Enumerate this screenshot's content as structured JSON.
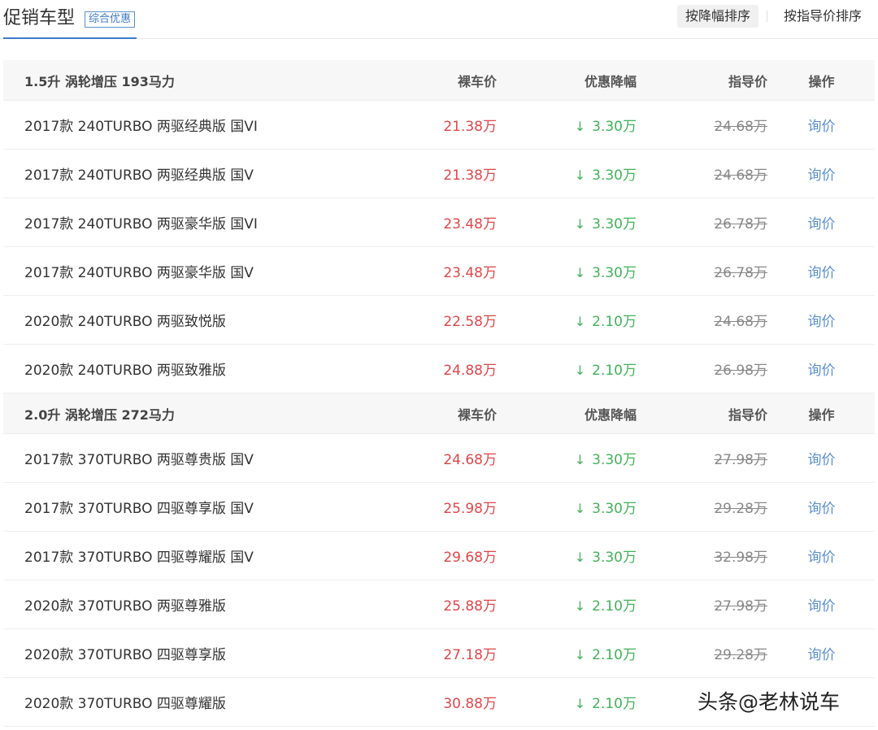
{
  "header": {
    "title": "促销车型",
    "badge": "综合优惠",
    "sort_discount": "按降幅排序",
    "sort_guide": "按指导价排序"
  },
  "groups": [
    {
      "name": "1.5升 涡轮增压 193马力",
      "col_price": "裸车价",
      "col_discount": "优惠降幅",
      "col_guide": "指导价",
      "col_op": "操作",
      "rows": [
        {
          "name": "2017款 240TURBO 两驱经典版 国VI",
          "price": "21.38万",
          "discount": "3.30万",
          "guide": "24.68万",
          "op": "询价"
        },
        {
          "name": "2017款 240TURBO 两驱经典版 国V",
          "price": "21.38万",
          "discount": "3.30万",
          "guide": "24.68万",
          "op": "询价"
        },
        {
          "name": "2017款 240TURBO 两驱豪华版 国VI",
          "price": "23.48万",
          "discount": "3.30万",
          "guide": "26.78万",
          "op": "询价"
        },
        {
          "name": "2017款 240TURBO 两驱豪华版 国V",
          "price": "23.48万",
          "discount": "3.30万",
          "guide": "26.78万",
          "op": "询价"
        },
        {
          "name": "2020款 240TURBO 两驱致悦版",
          "price": "22.58万",
          "discount": "2.10万",
          "guide": "24.68万",
          "op": "询价"
        },
        {
          "name": "2020款 240TURBO 两驱致雅版",
          "price": "24.88万",
          "discount": "2.10万",
          "guide": "26.98万",
          "op": "询价"
        }
      ]
    },
    {
      "name": "2.0升 涡轮增压 272马力",
      "col_price": "裸车价",
      "col_discount": "优惠降幅",
      "col_guide": "指导价",
      "col_op": "操作",
      "rows": [
        {
          "name": "2017款 370TURBO 两驱尊贵版 国V",
          "price": "24.68万",
          "discount": "3.30万",
          "guide": "27.98万",
          "op": "询价"
        },
        {
          "name": "2017款 370TURBO 四驱尊享版 国V",
          "price": "25.98万",
          "discount": "3.30万",
          "guide": "29.28万",
          "op": "询价"
        },
        {
          "name": "2017款 370TURBO 四驱尊耀版 国V",
          "price": "29.68万",
          "discount": "3.30万",
          "guide": "32.98万",
          "op": "询价"
        },
        {
          "name": "2020款 370TURBO 两驱尊雅版",
          "price": "25.88万",
          "discount": "2.10万",
          "guide": "27.98万",
          "op": "询价"
        },
        {
          "name": "2020款 370TURBO 四驱尊享版",
          "price": "27.18万",
          "discount": "2.10万",
          "guide": "29.28万",
          "op": "询价"
        },
        {
          "name": "2020款 370TURBO 四驱尊耀版",
          "price": "30.88万",
          "discount": "2.10万",
          "guide": "",
          "op": ""
        }
      ]
    }
  ],
  "icons": {
    "discount_arrow": "down-arrow-icon"
  },
  "colors": {
    "price": "#e0464a",
    "discount": "#42b25a",
    "link": "#5b8fd4",
    "accent": "#3d7bc8"
  },
  "watermark": "头条@老林说车"
}
